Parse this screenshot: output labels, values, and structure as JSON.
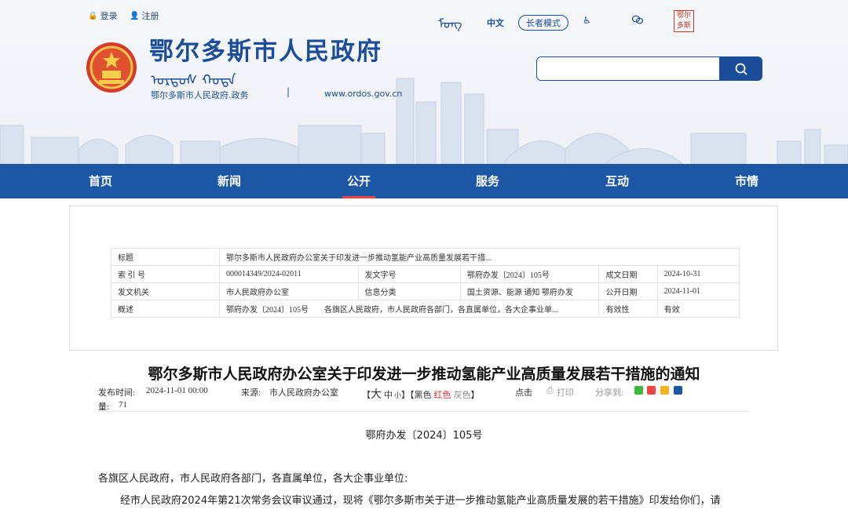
{
  "header": {
    "login": "登录",
    "register": "注册",
    "site_title": "鄂尔多斯市人民政府",
    "site_subtitle": "鄂尔多斯市人民政府.政务",
    "site_url": "www.ordos.gov.cn",
    "lang_chinese": "中文",
    "elder_mode": "长者模式",
    "stamp_text": "鄂尔多斯",
    "search_placeholder": ""
  },
  "nav": {
    "items": [
      {
        "label": "首页"
      },
      {
        "label": "新闻"
      },
      {
        "label": "公开",
        "active": true
      },
      {
        "label": "服务"
      },
      {
        "label": "互动"
      },
      {
        "label": "市情"
      }
    ]
  },
  "meta_table": {
    "title_label": "标题",
    "title_value": "鄂尔多斯市人民政府办公室关于印发进一步推动氢能产业高质量发展若干措...",
    "index_label": "索 引 号",
    "index_value": "000014349/2024-02011",
    "docno_label": "发文字号",
    "docno_value": "鄂府办发〔2024〕105号",
    "made_label": "成文日期",
    "made_value": "2024-10-31",
    "issuer_label": "发文机关",
    "issuer_value": "市人民政府办公室",
    "category_label": "信息分类",
    "category_value": "国土资源、能源 通知 鄂府办发",
    "pub_label": "公开日期",
    "pub_value": "2024-11-01",
    "summary_label": "概述",
    "summary_value": "鄂府办发〔2024〕105号　　各旗区人民政府，市人民政府各部门，各直属单位，各大企事业单...",
    "validity_label": "有效性",
    "validity_value": "有效"
  },
  "article": {
    "title": "鄂尔多斯市人民政府办公室关于印发进一步推动氢能产业高质量发展若干措施的通知",
    "publish_time_label": "发布时间:",
    "publish_time": "2024-11-01 00:00",
    "source_label": "来源:",
    "source": "市人民政府办公室",
    "font_size_open": "【",
    "font_large": "大",
    "font_medium": "中",
    "font_small": "小",
    "font_size_close": "】【",
    "color_black": "黑色",
    "color_red": "红色",
    "color_gray": "灰色",
    "color_close": "】",
    "clicks_label": "点击",
    "clicks_label_2": "量:",
    "clicks_value": "71",
    "print_label": "打印",
    "share_label": "分享到:",
    "doc_number": "鄂府办发〔2024〕105号",
    "addressee": "各旗区人民政府，市人民政府各部门，各直属单位，各大企事业单位:",
    "paragraph1": "经市人民政府2024年第21次常务会议审议通过，现将《鄂尔多斯市关于进一步推动氢能产业高质量发展的若干措施》印发给你们，请"
  },
  "colors": {
    "brand_blue": "#1b4d99",
    "nav_blue": "#1d56a4",
    "active_red": "#ee4444"
  }
}
